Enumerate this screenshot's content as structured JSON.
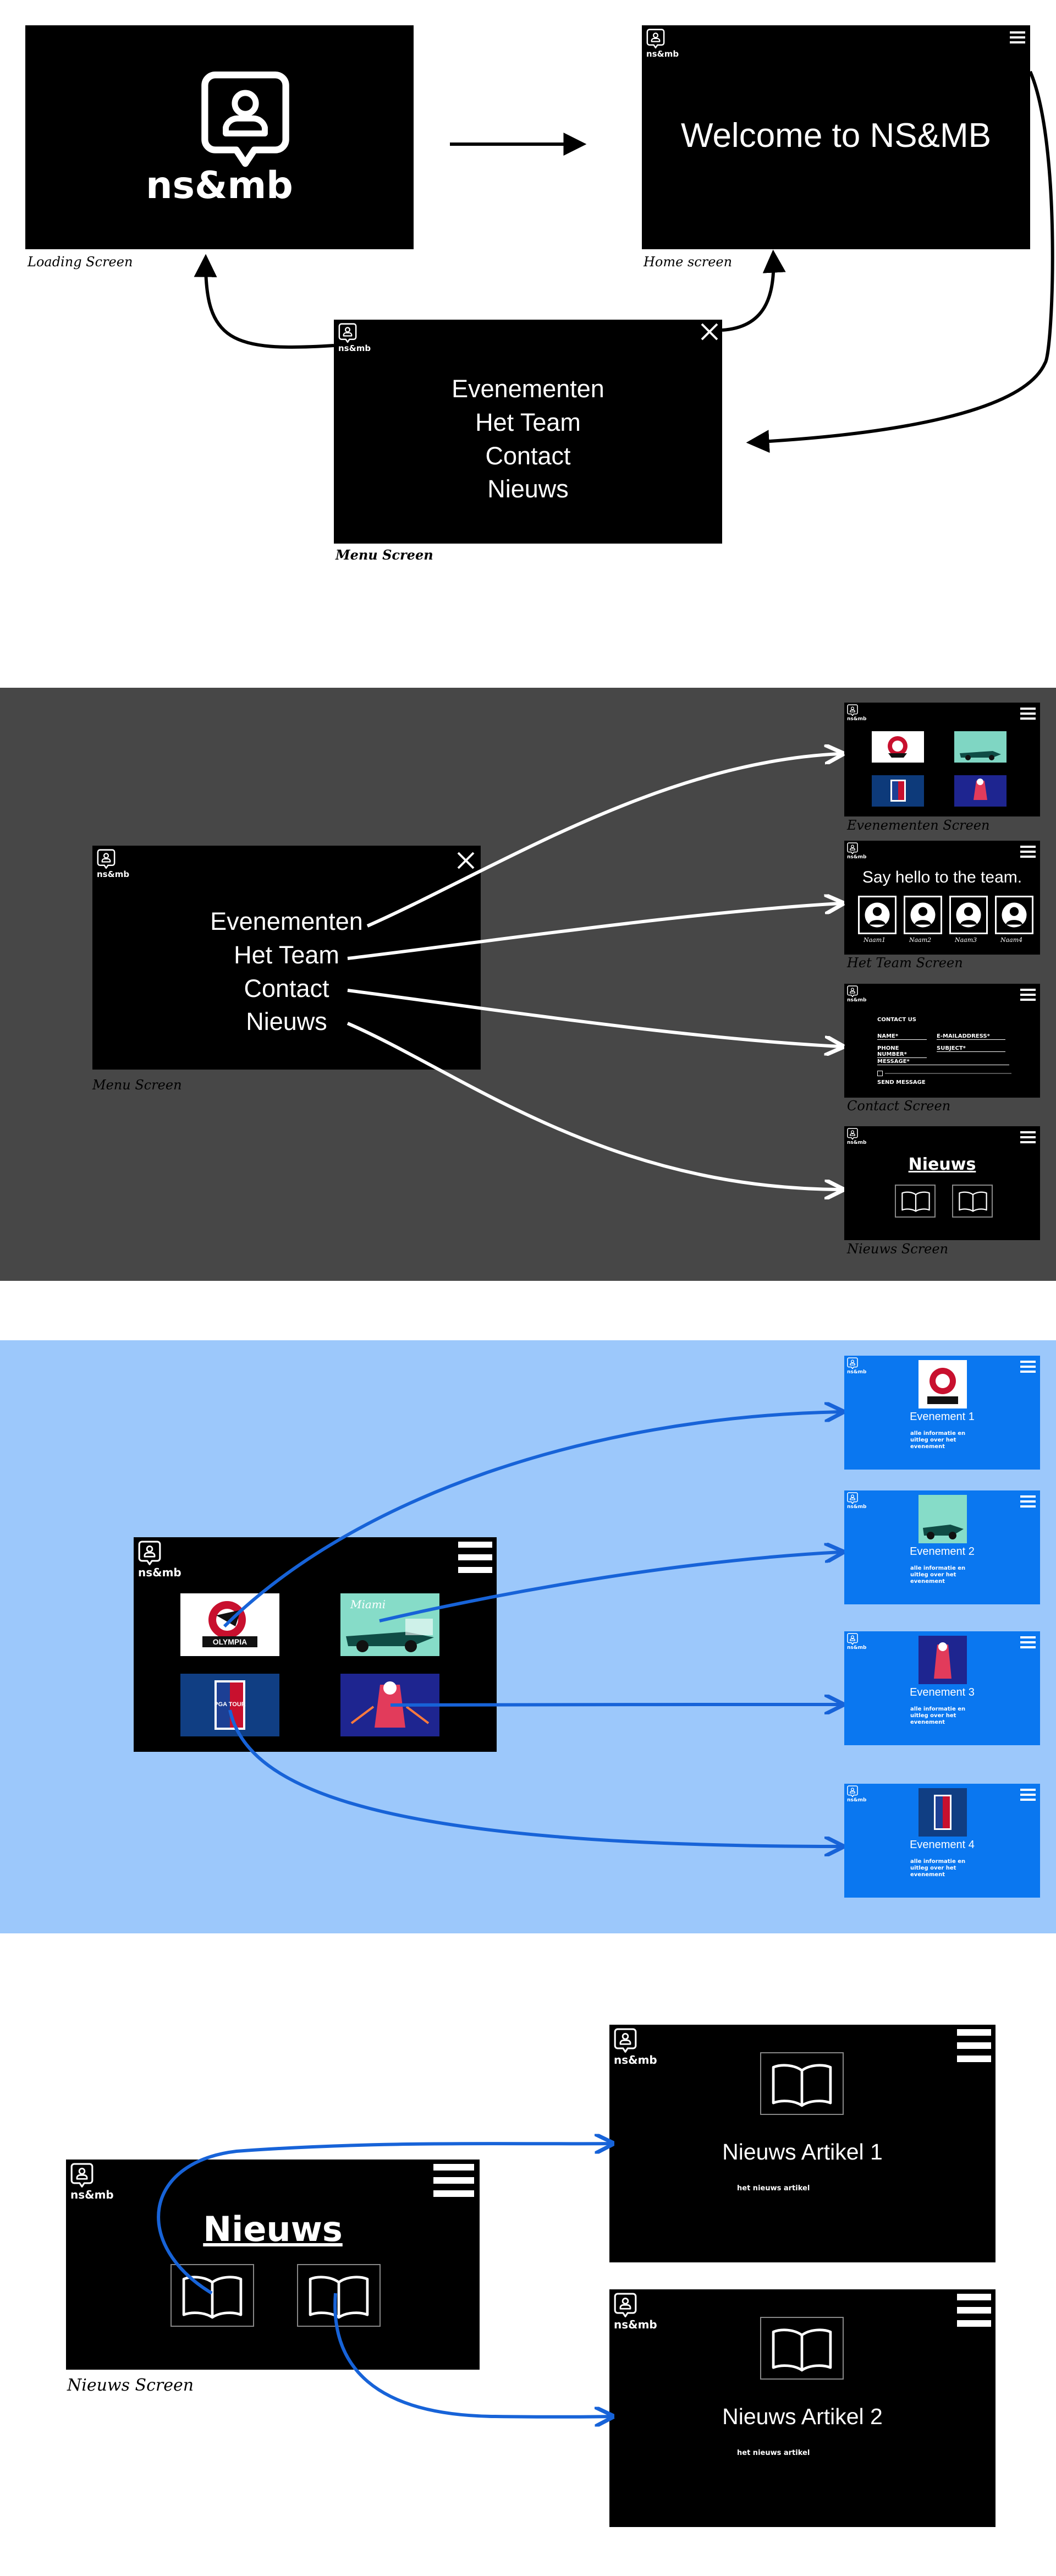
{
  "brand": "ns&mb",
  "colors": {
    "black": "#000000",
    "white": "#ffffff",
    "gray_band": "#474747",
    "blue_band": "#9cc8fb",
    "blue_screen": "#0a77f0",
    "arrow_blue": "#1763d8"
  },
  "section1": {
    "loading": {
      "brand": "ns&mb",
      "caption": "Loading Screen"
    },
    "home": {
      "welcome": "Welcome to NS&MB",
      "caption": "Home screen"
    },
    "menu": {
      "items": [
        "Evenementen",
        "Het Team",
        "Contact",
        "Nieuws"
      ],
      "caption": "Menu Screen"
    }
  },
  "section2": {
    "menu": {
      "items": [
        "Evenementen",
        "Het Team",
        "Contact",
        "Nieuws"
      ],
      "caption": "Menu Screen"
    },
    "evenementen": {
      "caption": "Evenementen Screen"
    },
    "team": {
      "title": "Say hello to the team.",
      "names": [
        "Naam1",
        "Naam2",
        "Naam3",
        "Naam4"
      ],
      "caption": "Het Team Screen"
    },
    "contact": {
      "heading": "CONTACT US",
      "name": "NAME*",
      "email": "E-MAILADDRESS*",
      "phone": "PHONE NUMBER*",
      "subject": "SUBJECT*",
      "message": "MESSAGE*",
      "send": "SEND MESSAGE",
      "caption": "Contact Screen"
    },
    "nieuws": {
      "title": "Nieuws",
      "caption": "Nieuws Screen"
    }
  },
  "section3": {
    "events": [
      {
        "title": "Evenement 1",
        "text": "alle informatie en uitleg over het evenement"
      },
      {
        "title": "Evenement 2",
        "text": "alle informatie en uitleg over het evenement"
      },
      {
        "title": "Evenement 3",
        "text": "alle informatie en uitleg over het evenement"
      },
      {
        "title": "Evenement 4",
        "text": "alle informatie en uitleg over het evenement"
      }
    ],
    "thumbs": {
      "olympia_title": "OLYMPIA",
      "miami": "Miami",
      "pga": "PGA TOUR"
    }
  },
  "section4": {
    "nieuws": {
      "title": "Nieuws",
      "caption": "Nieuws Screen"
    },
    "articles": [
      {
        "title": "Nieuws Artikel 1",
        "text": "het nieuws artikel"
      },
      {
        "title": "Nieuws Artikel 2",
        "text": "het nieuws artikel"
      }
    ]
  }
}
